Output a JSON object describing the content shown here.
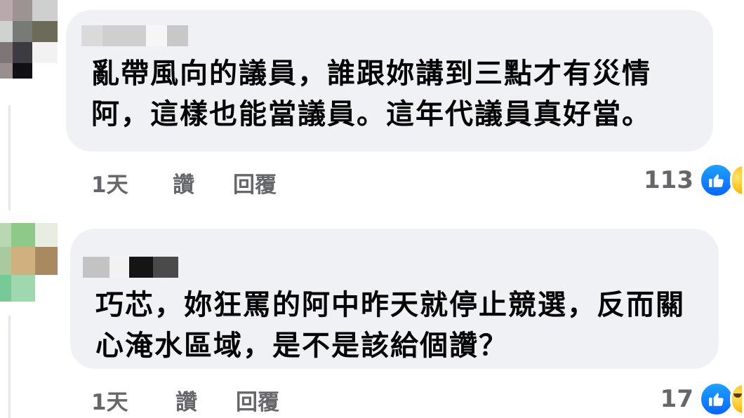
{
  "comments": [
    {
      "text_lines": [
        "亂帶風向的議員，誰跟妳講到三點才有災情",
        "阿，這樣也能當議員。這年代議員真好當。"
      ],
      "time": "1天",
      "like_label": "讚",
      "reply_label": "回覆",
      "reaction_count": "113",
      "reactions": [
        "like-icon",
        "haha-icon"
      ]
    },
    {
      "text_lines": [
        "巧芯，妳狂罵的阿中昨天就停止競選，反而關",
        "心淹水區域，是不是該給個讚？"
      ],
      "time": "1天",
      "like_label": "讚",
      "reply_label": "回覆",
      "reaction_count": "17",
      "reactions": [
        "like-icon",
        "haha-icon"
      ]
    }
  ]
}
